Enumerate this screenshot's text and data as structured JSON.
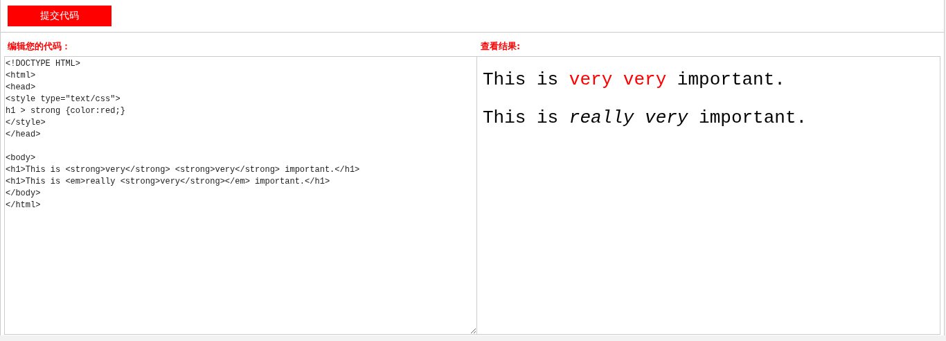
{
  "submit_button": {
    "label": "提交代码"
  },
  "editor": {
    "label": "编辑您的代码：",
    "code": "<!DOCTYPE HTML>\n<html>\n<head>\n<style type=\"text/css\">\nh1 > strong {color:red;}\n</style>\n</head>\n\n<body>\n<h1>This is <strong>very</strong> <strong>very</strong> important.</h1>\n<h1>This is <em>really <strong>very</strong></em> important.</h1>\n</body>\n</html>"
  },
  "result": {
    "label": "查看结果:",
    "headings": [
      {
        "segments": [
          {
            "text": "This is ",
            "kind": "plain"
          },
          {
            "text": "very very",
            "kind": "red"
          },
          {
            "text": " important.",
            "kind": "plain"
          }
        ]
      },
      {
        "segments": [
          {
            "text": "This is ",
            "kind": "plain"
          },
          {
            "text": "really very",
            "kind": "italic"
          },
          {
            "text": " important.",
            "kind": "plain"
          }
        ]
      }
    ]
  }
}
